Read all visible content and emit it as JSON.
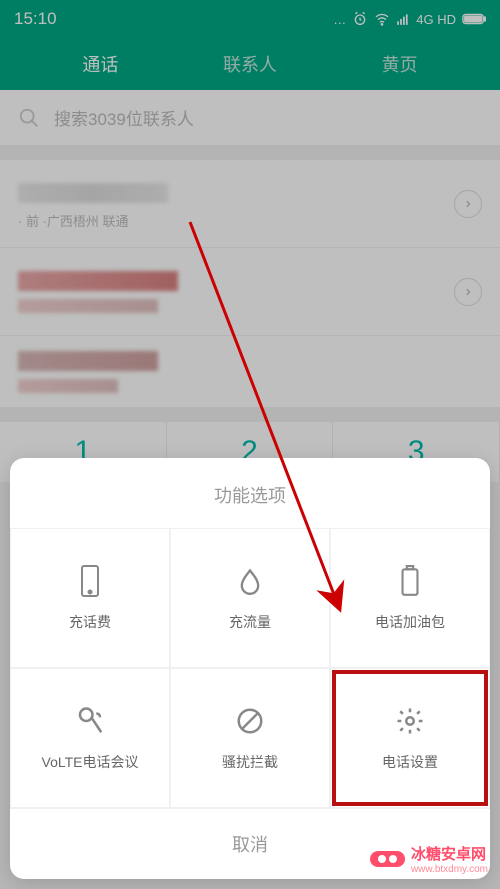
{
  "status": {
    "time": "15:10",
    "dots": "…",
    "net": "4G HD"
  },
  "header": {
    "tabs": [
      "通话",
      "联系人",
      "黄页"
    ],
    "activeIndex": 0
  },
  "search": {
    "placeholder": "搜索3039位联系人"
  },
  "rows": [
    {
      "sub": "·   前 ·广西梧州 联通"
    }
  ],
  "dialpad": [
    "1",
    "2",
    "3"
  ],
  "sheet": {
    "title": "功能选项",
    "items": [
      {
        "id": "topup-phone",
        "label": "充话费",
        "icon": "phone-rect"
      },
      {
        "id": "topup-data",
        "label": "充流量",
        "icon": "drop"
      },
      {
        "id": "phone-pack",
        "label": "电话加油包",
        "icon": "battery"
      },
      {
        "id": "volte-conf",
        "label": "VoLTE电话会议",
        "icon": "mic"
      },
      {
        "id": "block",
        "label": "骚扰拦截",
        "icon": "ban"
      },
      {
        "id": "phone-settings",
        "label": "电话设置",
        "icon": "gear",
        "highlight": true
      }
    ],
    "cancel": "取消"
  },
  "watermark": {
    "name": "冰糖安卓网",
    "url": "www.btxdmy.com"
  }
}
